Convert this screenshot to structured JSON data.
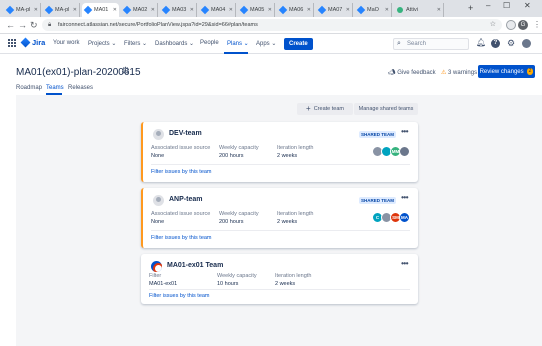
{
  "browser": {
    "tabs": [
      {
        "label": "MA-pl"
      },
      {
        "label": "MA-pl"
      },
      {
        "label": "MA01",
        "active": true
      },
      {
        "label": "MA02"
      },
      {
        "label": "MA03"
      },
      {
        "label": "MA04"
      },
      {
        "label": "MA05"
      },
      {
        "label": "MA06"
      },
      {
        "label": "MA07"
      },
      {
        "label": "MaO"
      },
      {
        "label": "Attivi"
      }
    ],
    "new_tab": "+",
    "minimize": "–",
    "maximize": "☐",
    "close": "✕",
    "back": "←",
    "forward": "→",
    "reload": "↻",
    "url": "fairconnect.atlassian.net/secure/PortfolioPlanView.jspa?id=29&sid=66#plan/teams",
    "profile_initial": "G"
  },
  "jira_nav": {
    "logo": "Jira",
    "items": [
      "Your work",
      "Projects ⌄",
      "Filters ⌄",
      "Dashboards ⌄",
      "People",
      "Plans ⌄",
      "Apps ⌄"
    ],
    "active_item": "Plans ⌄",
    "create_label": "Create",
    "search_placeholder": "Search",
    "icons": [
      "bell-icon",
      "help-icon",
      "settings-icon",
      "avatar"
    ]
  },
  "page": {
    "title": "MA01(ex01)-plan-20200615",
    "give_feedback": "Give feedback",
    "warnings": "3 warnings",
    "review_changes": "Review changes",
    "review_count": "2",
    "subtabs": [
      "Roadmap",
      "Teams",
      "Releases"
    ],
    "active_subtab": "Teams"
  },
  "actions": {
    "add_team": "Create team",
    "manage_shared": "Manage shared teams"
  },
  "teams": [
    {
      "name": "DEV-team",
      "badge": "SHARED TEAM",
      "field1_label": "Associated issue source",
      "field1_value": "None",
      "capacity_label": "Weekly capacity",
      "capacity_value": "200 hours",
      "iteration_label": "Iteration length",
      "iteration_value": "2 weeks",
      "link": "Filter issues by this team",
      "members": [
        {
          "initials": "",
          "color": "#8993a4"
        },
        {
          "initials": "",
          "color": "#00a3bf"
        },
        {
          "initials": "MM",
          "color": "#36b37e"
        },
        {
          "initials": "",
          "color": "#6b778c"
        }
      ]
    },
    {
      "name": "ANP-team",
      "badge": "SHARED TEAM",
      "field1_label": "Associated issue source",
      "field1_value": "None",
      "capacity_label": "Weekly capacity",
      "capacity_value": "200 hours",
      "iteration_label": "Iteration length",
      "iteration_value": "2 weeks",
      "link": "Filter issues by this team",
      "members": [
        {
          "initials": "C",
          "color": "#00a3bf"
        },
        {
          "initials": "",
          "color": "#8993a4"
        },
        {
          "initials": "SM",
          "color": "#de350b"
        },
        {
          "initials": "MA",
          "color": "#0052cc"
        }
      ]
    },
    {
      "name": "MA01-ex01 Team",
      "field1_label": "Filter",
      "field1_value": "MA01-ex01",
      "capacity_label": "Weekly capacity",
      "capacity_value": "10 hours",
      "iteration_label": "Iteration length",
      "iteration_value": "2 weeks",
      "link": "Filter issues by this team"
    }
  ]
}
